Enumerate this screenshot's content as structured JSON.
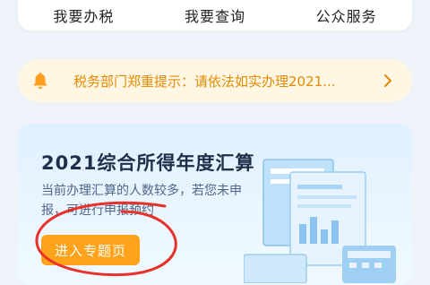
{
  "nav": {
    "items": [
      {
        "label": "我要办税"
      },
      {
        "label": "我要查询"
      },
      {
        "label": "公众服务"
      }
    ]
  },
  "notice": {
    "icon": "bell-icon",
    "text": "税务部门郑重提示：请依法如实办理2021...",
    "chevron": "chevron-right-icon",
    "color": "#e28b00"
  },
  "promo": {
    "title": "2021综合所得年度汇算",
    "desc": "当前办理汇算的人数较多，若您未申报，可进行申报预约",
    "button": "进入专题页",
    "button_color": "#ffa31a",
    "annotation_color": "#e8312a"
  }
}
